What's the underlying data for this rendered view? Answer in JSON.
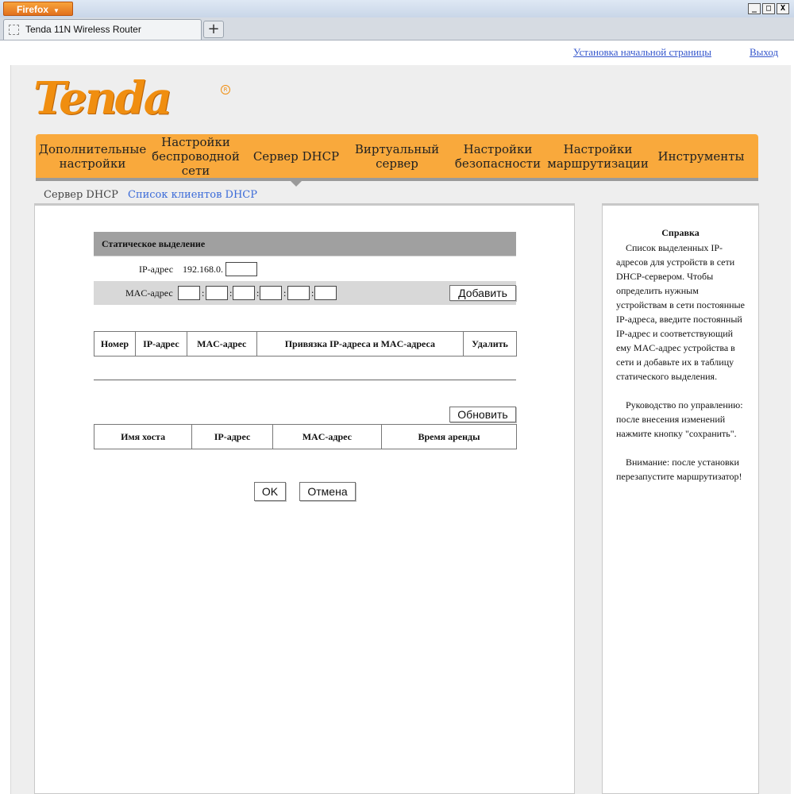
{
  "browser": {
    "app_button": "Firefox",
    "tab_title": "Tenda 11N Wireless Router",
    "new_tab": "+",
    "window_controls": [
      "_",
      "□",
      "X"
    ]
  },
  "top_links": {
    "home_setup": "Установка начальной страницы",
    "logout": "Выход"
  },
  "logo": {
    "text": "Tenda",
    "reg": "R"
  },
  "nav": {
    "items": [
      "Дополнительные настройки",
      "Настройки беспроводной сети",
      "Сервер DHCP",
      "Виртуальный сервер",
      "Настройки безопасности",
      "Настройки маршрутизации",
      "Инструменты"
    ],
    "active_index": 2
  },
  "subnav": {
    "current": "Сервер DHCP",
    "link": "Список клиентов DHCP"
  },
  "static": {
    "title": "Статическое выделение",
    "ip_label": "IP-адрес",
    "ip_prefix": "192.168.0.",
    "ip_value": "",
    "mac_label": "MAC-адрес",
    "mac_sep": ":",
    "add_button": "Добавить"
  },
  "binding_table": {
    "headers": [
      "Номер",
      "IP-адрес",
      "MAC-адрес",
      "Привязка IP-адреса и MAC-адреса",
      "Удалить"
    ]
  },
  "refresh_button": "Обновить",
  "clients_table": {
    "headers": [
      "Имя хоста",
      "IP-адрес",
      "MAC-адрес",
      "Время аренды"
    ]
  },
  "actions": {
    "ok": "OK",
    "cancel": "Отмена"
  },
  "help": {
    "title": "Справка",
    "p1": "Список выделенных IP-адресов для устройств в сети DHCP-сервером. Чтобы определить нужным устройствам в сети постоянные IP-адреса, введите постоянный IP-адрес и соответствующий ему MAC-адрес устройства в сети и добавьте их в таблицу статического выделения.",
    "p2": "Руководство по управлению: после внесения изменений нажмите кнопку \"сохранить\".",
    "p3": "Внимание: после установки перезапустите маршрутизатор!"
  },
  "colors": {
    "accent": "#f9a93c",
    "logo": "#f08e10",
    "link": "#3355cc"
  }
}
